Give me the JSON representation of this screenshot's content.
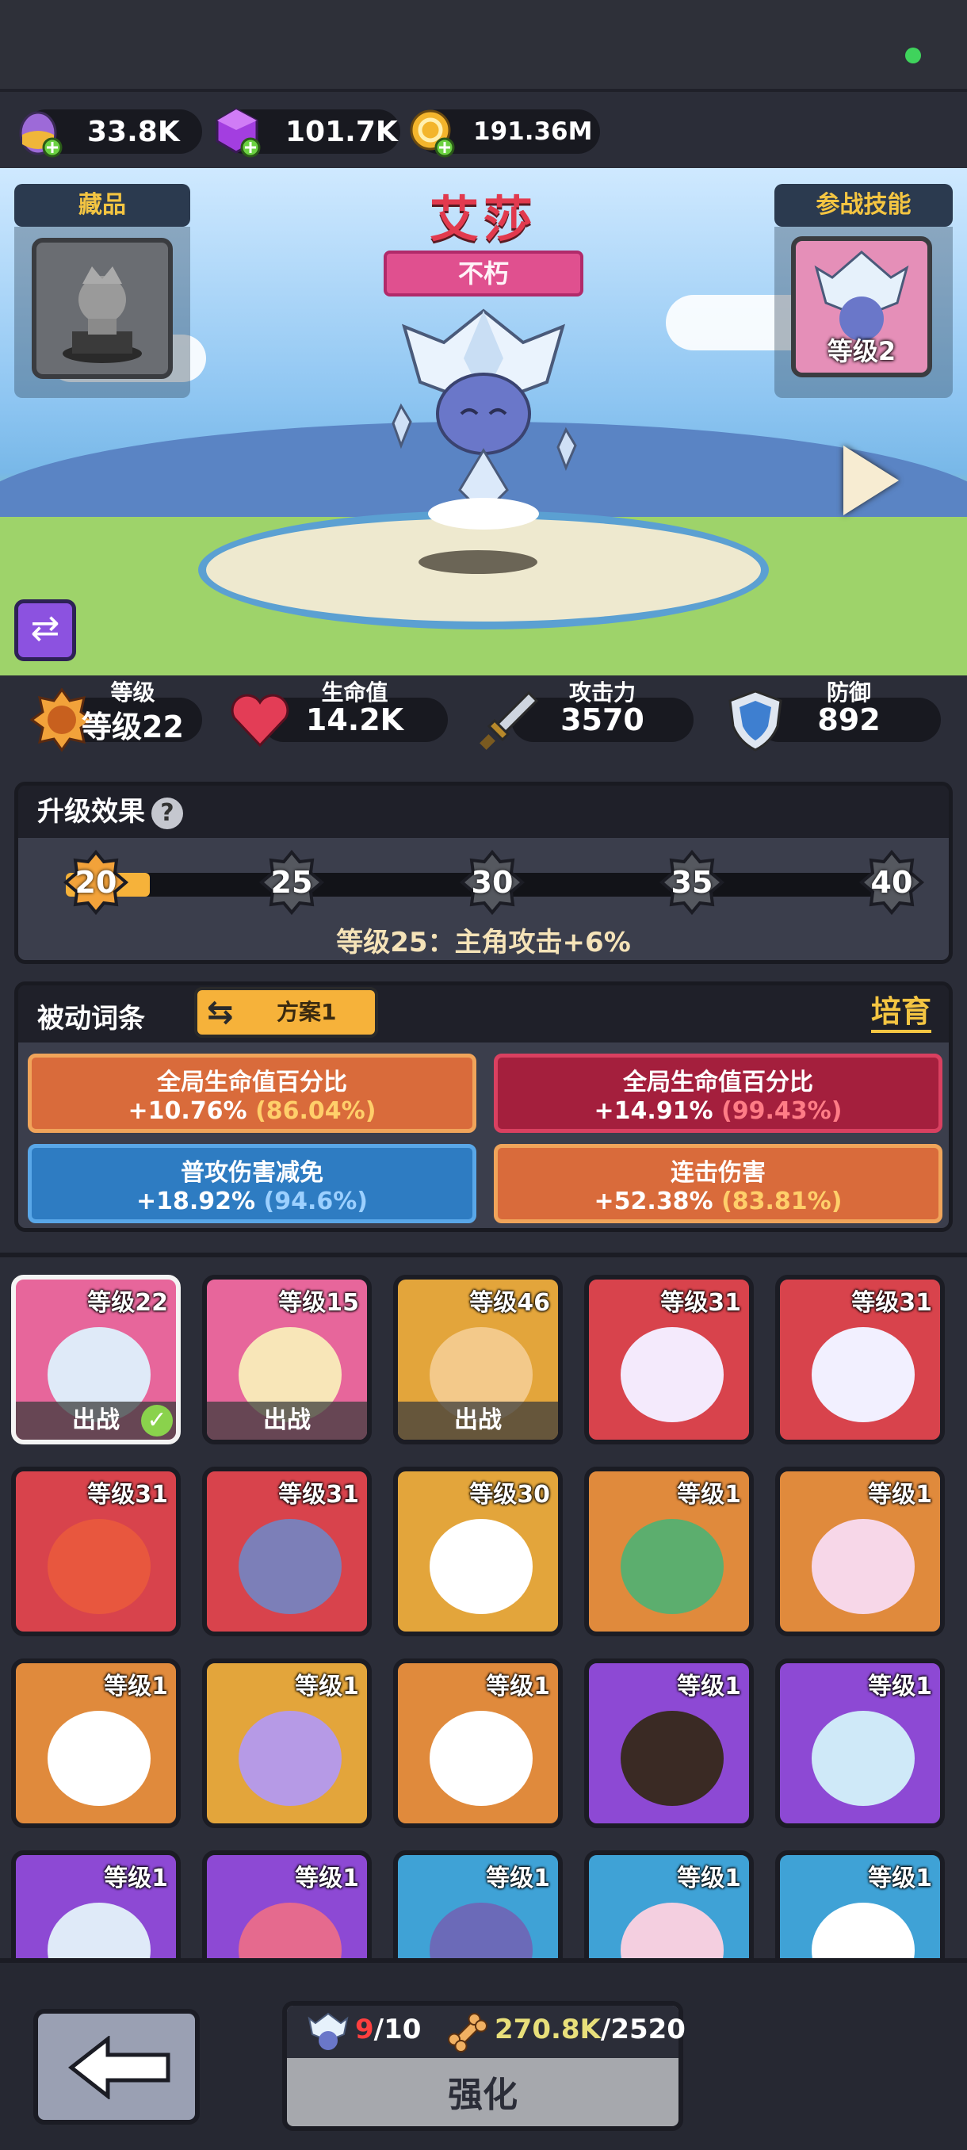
{
  "currencies": [
    {
      "icon": "purple-egg-icon",
      "value": "33.8K"
    },
    {
      "icon": "purple-gem-icon",
      "value": "101.7K"
    },
    {
      "icon": "gold-coin-icon",
      "value": "191.36M"
    }
  ],
  "stage": {
    "collection_label": "藏品",
    "skill_label": "参战技能",
    "skill_level": "等级2",
    "hero_name": "艾莎",
    "rarity": "不朽"
  },
  "stats": [
    {
      "icon": "level-badge-icon",
      "label": "等级",
      "value": "等级22"
    },
    {
      "icon": "heart-icon",
      "label": "生命值",
      "value": "14.2K"
    },
    {
      "icon": "sword-icon",
      "label": "攻击力",
      "value": "3570"
    },
    {
      "icon": "shield-icon",
      "label": "防御",
      "value": "892"
    }
  ],
  "upgrade": {
    "title": "升级效果",
    "help": "?",
    "milestones": [
      "20",
      "25",
      "30",
      "35",
      "40"
    ],
    "progress": 0.1,
    "effect_text": "等级25：主角攻击+6%"
  },
  "passive": {
    "title": "被动词条",
    "plan_label": "方案1",
    "cultivate_label": "培育",
    "traits": [
      {
        "name": "全局生命值百分比",
        "value": "+10.76%",
        "max": "(86.04%)"
      },
      {
        "name": "全局生命值百分比",
        "value": "+14.91%",
        "max": "(99.43%)"
      },
      {
        "name": "普攻伤害减免",
        "value": "+18.92%",
        "max": "(94.6%)"
      },
      {
        "name": "连击伤害",
        "value": "+52.38%",
        "max": "(83.81%)"
      }
    ]
  },
  "roster": {
    "deploy_label": "出战",
    "cards": [
      {
        "level": "等级22",
        "deployed": true,
        "selected": true
      },
      {
        "level": "等级15",
        "deployed": true
      },
      {
        "level": "等级46",
        "deployed": true
      },
      {
        "level": "等级31"
      },
      {
        "level": "等级31"
      },
      {
        "level": "等级31"
      },
      {
        "level": "等级31"
      },
      {
        "level": "等级30"
      },
      {
        "level": "等级1"
      },
      {
        "level": "等级1"
      },
      {
        "level": "等级1"
      },
      {
        "level": "等级1"
      },
      {
        "level": "等级1"
      },
      {
        "level": "等级1"
      },
      {
        "level": "等级1"
      },
      {
        "level": "等级1"
      },
      {
        "level": "等级1"
      },
      {
        "level": "等级1"
      },
      {
        "level": "等级1"
      },
      {
        "level": "等级1"
      }
    ]
  },
  "footer": {
    "count_current": "9",
    "count_total": "/10",
    "cost_have": "270.8K",
    "cost_need": "/2520",
    "enhance_label": "强化"
  }
}
